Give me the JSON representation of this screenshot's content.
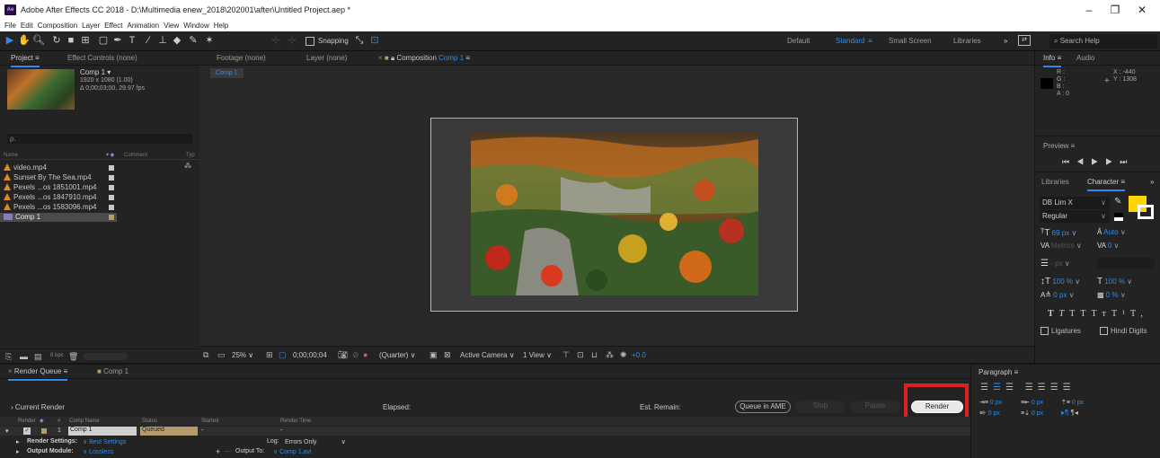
{
  "titlebar": {
    "app_icon": "Ae",
    "title": "Adobe After Effects CC 2018 - D:\\Multimedia enew_2018\\202001\\after\\Untitled Project.aep *"
  },
  "menu": [
    "File",
    "Edit",
    "Composition",
    "Layer",
    "Effect",
    "Animation",
    "View",
    "Window",
    "Help"
  ],
  "toolbar": {
    "snapping_label": "Snapping",
    "workspaces": [
      "Default",
      "Standard",
      "Small Screen",
      "Libraries"
    ],
    "active_workspace": "Standard",
    "search_placeholder": "Search Help"
  },
  "project_panel": {
    "tab_project": "Project",
    "tab_effect_controls": "Effect Controls (none)",
    "comp_name": "Comp 1 ▾",
    "comp_size": "1920 x 1080 (1.00)",
    "comp_duration": "Δ 0;00;03;00, 29.97 fps",
    "search_placeholder": "ρ.",
    "col_name": "Name",
    "col_comment": "Comment",
    "col_type": "Typ",
    "items": [
      {
        "name": "video.mp4",
        "type": "file"
      },
      {
        "name": "Sunset By The Sea.mp4",
        "type": "file"
      },
      {
        "name": "Pexels ...os 1851001.mp4",
        "type": "file"
      },
      {
        "name": "Pexels ...os 1847910.mp4",
        "type": "file"
      },
      {
        "name": "Pexels ...os 1583096.mp4",
        "type": "file"
      },
      {
        "name": "Comp 1",
        "type": "comp"
      }
    ],
    "bpc": "8 bpc"
  },
  "viewer_tabs": {
    "footage": "Footage (none)",
    "layer": "Layer (none)",
    "composition": "Composition",
    "composition_name": "Comp 1",
    "breadcrumb": "Comp 1"
  },
  "viewer_controls": {
    "zoom": "25%",
    "timecode": "0;00;00;04",
    "resolution": "(Quarter)",
    "camera": "Active Camera",
    "view": "1 View",
    "exposure": "+0.0"
  },
  "info_panel": {
    "tab_info": "Info",
    "tab_audio": "Audio",
    "r": "R :",
    "g": "G :",
    "b": "B :",
    "a": "A : 0",
    "x": "X : -440",
    "y": "Y : 1308"
  },
  "preview_panel": {
    "title": "Preview"
  },
  "character_panel": {
    "tab_libraries": "Libraries",
    "tab_character": "Character",
    "font": "DB Lim X",
    "style": "Regular",
    "font_size": "69 px",
    "leading": "Auto",
    "kerning": "Metrics",
    "tracking": "0",
    "stroke": "- px",
    "v_scale": "100 %",
    "h_scale": "100 %",
    "baseline": "0 px",
    "tsume": "0 %",
    "styles": [
      "T",
      "T",
      "TT",
      "Tт",
      "T¹",
      "T,"
    ],
    "ligatures": "Ligatures",
    "hindi_digits": "Hindi Digits",
    "fill_color": "#ffd400"
  },
  "render_queue": {
    "tab_render_queue": "Render Queue",
    "tab_comp": "Comp 1",
    "current_render": "Current Render",
    "elapsed": "Elapsed:",
    "est_remain": "Est. Remain:",
    "queue_in_ame": "Queue in AME",
    "stop": "Stop",
    "pause": "Pause",
    "render": "Render",
    "columns": [
      "Render",
      "#",
      "Comp Name",
      "Status",
      "Started",
      "Render Time"
    ],
    "item": {
      "num": "1",
      "comp": "Comp 1",
      "status": "Queued",
      "started": "-",
      "render_time": "-"
    },
    "render_settings_label": "Render Settings:",
    "render_settings_value": "Best Settings",
    "log_label": "Log:",
    "log_value": "Errors Only",
    "output_module_label": "Output Module:",
    "output_module_value": "Lossless",
    "output_to_label": "Output To:",
    "output_to_value": "Comp 1.avi"
  },
  "paragraph_panel": {
    "title": "Paragraph",
    "indent_left": "0 px",
    "indent_first": "0 px",
    "space_before": "0 px",
    "space_after": "0 px",
    "indent_right": "0 px"
  },
  "colors": {
    "accent": "#2d8ceb",
    "highlight_red": "#e02020",
    "label_tan": "#b59a6d"
  }
}
